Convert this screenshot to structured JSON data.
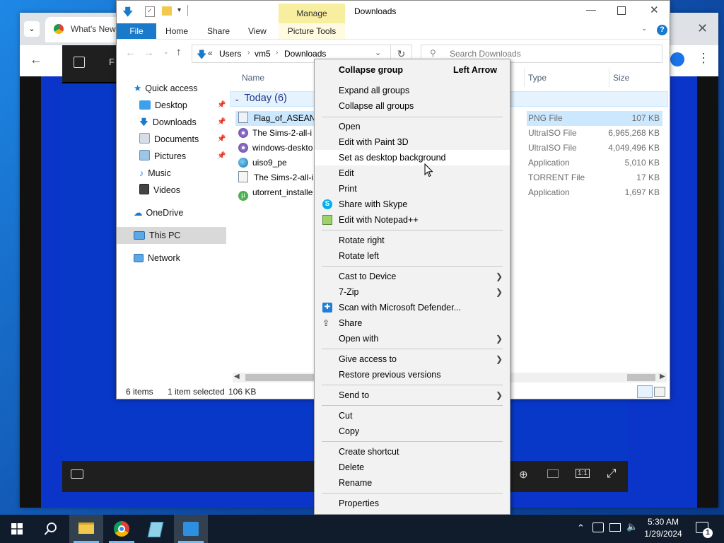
{
  "chrome": {
    "tab_title": "What's New"
  },
  "explorer": {
    "window_title": "Downloads",
    "ribbon": {
      "file": "File",
      "home": "Home",
      "share": "Share",
      "view": "View",
      "manage": "Manage",
      "picture_tools": "Picture Tools"
    },
    "address": {
      "prefix": "«",
      "crumbs": [
        "Users",
        "vm5",
        "Downloads"
      ]
    },
    "search_placeholder": "Search Downloads",
    "nav": {
      "quick_access": "Quick access",
      "items": [
        "Desktop",
        "Downloads",
        "Documents",
        "Pictures",
        "Music",
        "Videos"
      ],
      "onedrive": "OneDrive",
      "this_pc": "This PC",
      "network": "Network"
    },
    "columns": {
      "name": "Name",
      "type": "Type",
      "size": "Size"
    },
    "group": "Today (6)",
    "files": [
      {
        "name": "Flag_of_ASEAN",
        "type": "PNG File",
        "size": "107 KB"
      },
      {
        "name": "The Sims-2-all-i",
        "type": "UltraISO File",
        "size": "6,965,268 KB"
      },
      {
        "name": "windows-deskto",
        "type": "UltraISO File",
        "size": "4,049,496 KB"
      },
      {
        "name": "uiso9_pe",
        "type": "Application",
        "size": "5,010 KB"
      },
      {
        "name": "The Sims-2-all-i",
        "type": "TORRENT File",
        "size": "17 KB"
      },
      {
        "name": "utorrent_installe",
        "type": "Application",
        "size": "1,697 KB"
      }
    ],
    "status": {
      "count": "6 items",
      "selected": "1 item selected",
      "size": "106 KB"
    }
  },
  "context_menu": {
    "header": {
      "label": "Collapse group",
      "shortcut": "Left Arrow"
    },
    "items": [
      "Expand all groups",
      "Collapse all groups",
      "Open",
      "Edit with Paint 3D",
      "Set as desktop background",
      "Edit",
      "Print",
      "Share with Skype",
      "Edit with Notepad++",
      "Rotate right",
      "Rotate left",
      "Cast to Device",
      "7-Zip",
      "Scan with Microsoft Defender...",
      "Share",
      "Open with",
      "Give access to",
      "Restore previous versions",
      "Send to",
      "Cut",
      "Copy",
      "Create shortcut",
      "Delete",
      "Rename",
      "Properties"
    ]
  },
  "photos": {
    "zoom_ratio": "1:1"
  },
  "taskbar": {
    "time": "5:30 AM",
    "date": "1/29/2024",
    "notification_count": "1"
  },
  "colors": {
    "accent": "#1979ca",
    "taskbar": "#101c2c",
    "manage": "#f8eea0"
  }
}
